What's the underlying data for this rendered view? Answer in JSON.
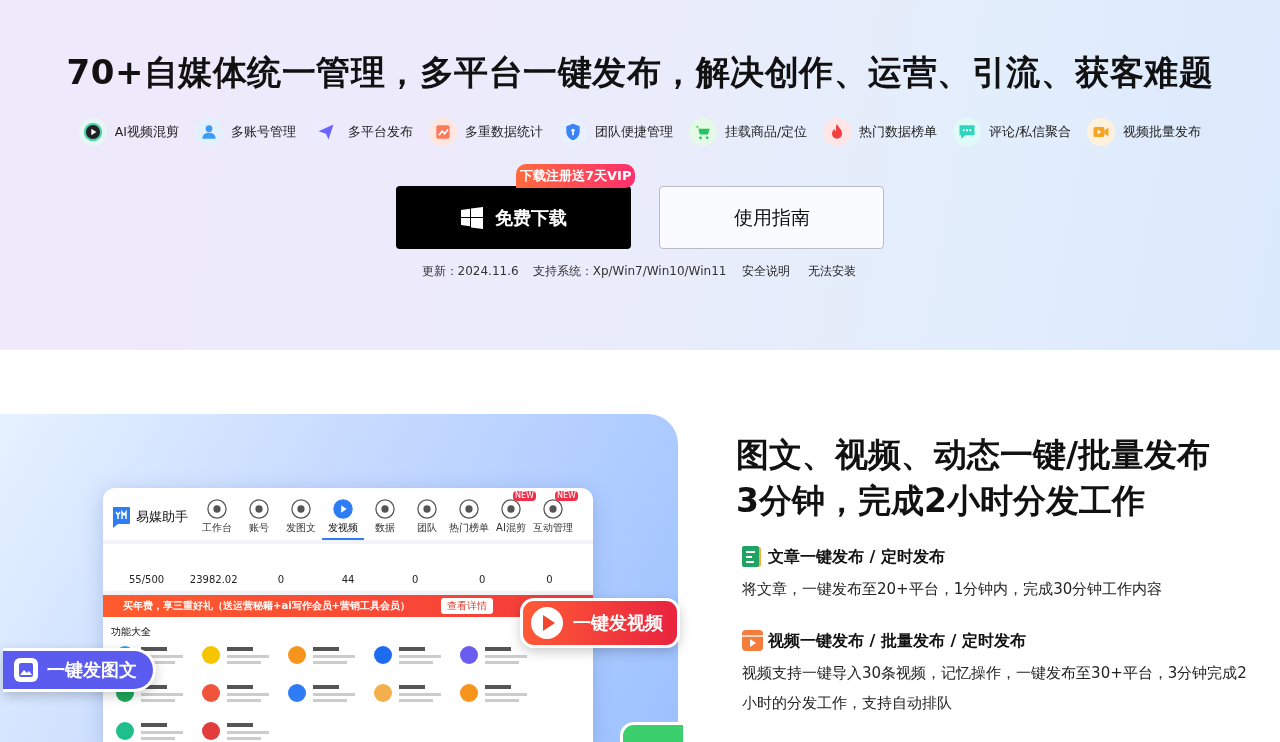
{
  "hero": {
    "title": "70+自媒体统一管理，多平台一键发布，解决创作、运营、引流、获客难题",
    "features": [
      {
        "label": "AI视频混剪"
      },
      {
        "label": "多账号管理"
      },
      {
        "label": "多平台发布"
      },
      {
        "label": "多重数据统计"
      },
      {
        "label": "团队便捷管理"
      },
      {
        "label": "挂载商品/定位"
      },
      {
        "label": "热门数据榜单"
      },
      {
        "label": "评论/私信聚合"
      },
      {
        "label": "视频批量发布"
      }
    ],
    "download_button": {
      "label": "免费下载",
      "badge": "下载注册送7天VIP"
    },
    "guide_button": {
      "label": "使用指南"
    },
    "info": [
      {
        "kind": "text",
        "text": "更新：2024.11.6"
      },
      {
        "kind": "text",
        "text": "支持系统：Xp/Win7/Win10/Win11"
      },
      {
        "kind": "link",
        "text": "安全说明"
      },
      {
        "kind": "link",
        "text": "无法安装"
      }
    ]
  },
  "showcase": {
    "app": {
      "name": "易媒助手",
      "nav": [
        {
          "label": "工作台",
          "selected": false
        },
        {
          "label": "账号",
          "selected": false
        },
        {
          "label": "发图文",
          "selected": false
        },
        {
          "label": "发视频",
          "selected": true
        },
        {
          "label": "数据",
          "selected": false
        },
        {
          "label": "团队",
          "selected": false
        },
        {
          "label": "热门榜单",
          "selected": false
        },
        {
          "label": "AI混剪",
          "selected": false,
          "badge": "NEW"
        },
        {
          "label": "互动管理",
          "selected": false,
          "badge": "NEW"
        }
      ],
      "stats": [
        "55/500",
        "23982.02",
        "0",
        "44",
        "0",
        "0",
        "0"
      ],
      "promo": {
        "text": "买年费，享三重好礼（送运营秘籍+ai写作会员+营销工具会员）",
        "button": "查看详情"
      },
      "section_title": "功能大全"
    },
    "video_badge": "一键发视频",
    "image_badge": "一键发图文"
  },
  "headline": [
    "图文、视频、动态一键/批量发布",
    "3分钟，完成2小时分发工作"
  ],
  "blocks": [
    {
      "kind": "article",
      "title": "文章一键发布 / 定时发布",
      "text": "将文章，一键发布至20+平台，1分钟内，完成30分钟工作内容"
    },
    {
      "kind": "video",
      "title": "视频一键发布 / 批量发布 / 定时发布",
      "text": "视频支持一键导入30条视频，记忆操作，一键发布至30+平台，3分钟完成2小时的分发工作，支持自动排队"
    }
  ]
}
